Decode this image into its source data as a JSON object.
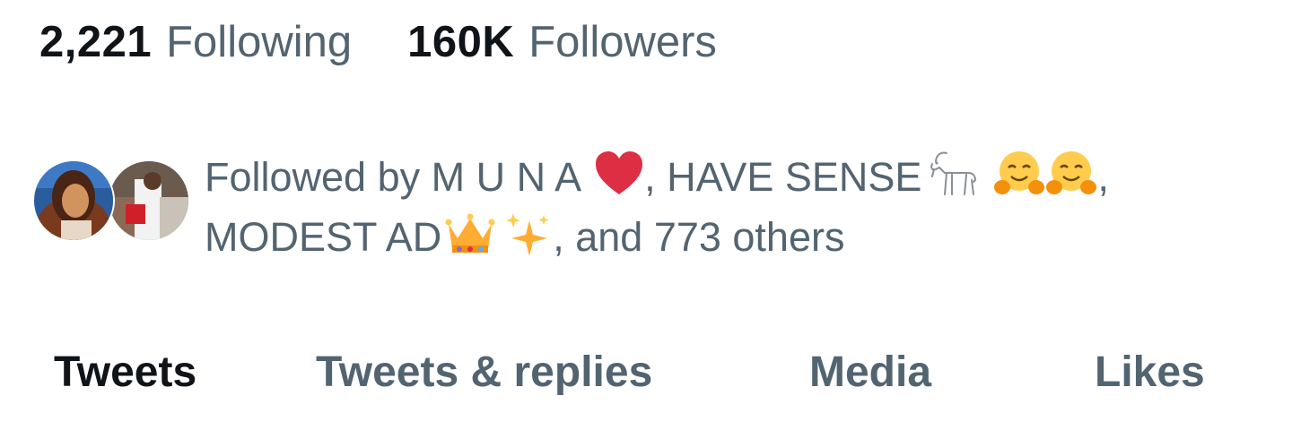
{
  "stats": {
    "following_count": "2,221",
    "following_label": "Following",
    "followers_count": "160K",
    "followers_label": "Followers"
  },
  "followed_by": {
    "prefix": "Followed by ",
    "user1": "M U N A",
    "user1_emoji": "red-heart",
    "sep1": ", ",
    "user2": "HAVE SENSE",
    "user2_emojis": [
      "goat",
      "hugging-face",
      "hugging-face"
    ],
    "sep2": ",",
    "user3": "MODEST AD",
    "user3_emojis": [
      "crown",
      "sparkles"
    ],
    "suffix": ", and 773 others",
    "avatars": [
      "avatar-icon",
      "avatar-icon"
    ]
  },
  "tabs": [
    {
      "label": "Tweets",
      "active": true
    },
    {
      "label": "Tweets & replies",
      "active": false
    },
    {
      "label": "Media",
      "active": false
    },
    {
      "label": "Likes",
      "active": false
    }
  ],
  "colors": {
    "primary_text": "#0f1419",
    "secondary_text": "#536471",
    "background": "#ffffff",
    "heart": "#dd2e44"
  }
}
